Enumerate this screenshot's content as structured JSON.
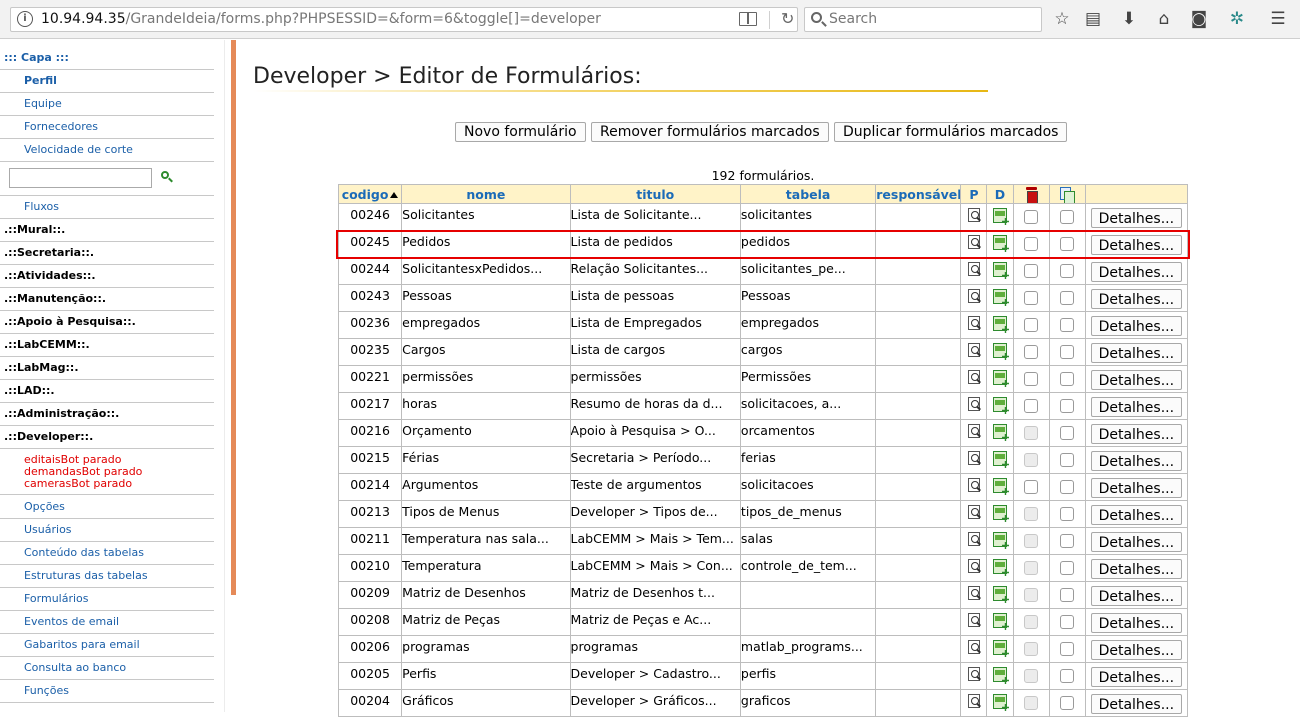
{
  "browser": {
    "url_host": "10.94.94.35",
    "url_path": "/GrandeIdeia/forms.php?PHPSESSID=&form=6&toggle[]=developer",
    "search_placeholder": "Search"
  },
  "sidebar": {
    "capa": "::: Capa :::",
    "capa_items": [
      "Perfil",
      "Equipe",
      "Fornecedores",
      "Velocidade de corte"
    ],
    "search_value": "",
    "fluxos": "Fluxos",
    "sections": [
      ".::Mural::.",
      ".::Secretaria::.",
      ".::Atividades::.",
      ".::Manutenção::.",
      ".::Apoio à Pesquisa::.",
      ".::LabCEMM::.",
      ".::LabMag::.",
      ".::LAD::.",
      ".::Administração::.",
      ".::Developer::."
    ],
    "bot_status": [
      "editaisBot parado",
      "demandasBot parado",
      "camerasBot parado"
    ],
    "developer_items": [
      "Opções",
      "Usuários",
      "Conteúdo das tabelas",
      "Estruturas das tabelas",
      "Formulários",
      "Eventos de email",
      "Gabaritos para email",
      "Consulta ao banco",
      "Funções"
    ]
  },
  "main": {
    "title": "Developer > Editor de Formulários:",
    "buttons": {
      "new": "Novo formulário",
      "remove": "Remover formulários marcados",
      "duplicate": "Duplicar formulários marcados"
    },
    "count": "192 formulários.",
    "columns": {
      "codigo": "codigo",
      "nome": "nome",
      "titulo": "titulo",
      "tabela": "tabela",
      "responsavel": "responsável",
      "p": "P",
      "d": "D"
    },
    "details_label": "Detalhes...",
    "rows": [
      {
        "codigo": "00246",
        "nome": "Solicitantes",
        "titulo": "Lista de Solicitante...",
        "tabela": "solicitantes",
        "responsavel": "",
        "del_enabled": true
      },
      {
        "codigo": "00245",
        "nome": "Pedidos",
        "titulo": "Lista de pedidos",
        "tabela": "pedidos",
        "responsavel": "",
        "del_enabled": true
      },
      {
        "codigo": "00244",
        "nome": "SolicitantesxPedidos...",
        "titulo": "Relação Solicitantes...",
        "tabela": "solicitantes_pe...",
        "responsavel": "",
        "del_enabled": true
      },
      {
        "codigo": "00243",
        "nome": "Pessoas",
        "titulo": "Lista de pessoas",
        "tabela": "Pessoas",
        "responsavel": "",
        "del_enabled": true
      },
      {
        "codigo": "00236",
        "nome": "empregados",
        "titulo": "Lista de Empregados",
        "tabela": "empregados",
        "responsavel": "",
        "del_enabled": true
      },
      {
        "codigo": "00235",
        "nome": "Cargos",
        "titulo": "Lista de cargos",
        "tabela": "cargos",
        "responsavel": "",
        "del_enabled": true
      },
      {
        "codigo": "00221",
        "nome": "permissões",
        "titulo": "permissões",
        "tabela": "Permissões",
        "responsavel": "",
        "del_enabled": true
      },
      {
        "codigo": "00217",
        "nome": "horas",
        "titulo": "Resumo de horas da d...",
        "tabela": "solicitacoes, a...",
        "responsavel": "",
        "del_enabled": true
      },
      {
        "codigo": "00216",
        "nome": "Orçamento",
        "titulo": "Apoio à Pesquisa > O...",
        "tabela": "orcamentos",
        "responsavel": "",
        "del_enabled": false
      },
      {
        "codigo": "00215",
        "nome": "Férias",
        "titulo": "Secretaria > Período...",
        "tabela": "ferias",
        "responsavel": "",
        "del_enabled": false
      },
      {
        "codigo": "00214",
        "nome": "Argumentos",
        "titulo": "Teste de argumentos",
        "tabela": "solicitacoes",
        "responsavel": "",
        "del_enabled": true
      },
      {
        "codigo": "00213",
        "nome": "Tipos de Menus",
        "titulo": "Developer > Tipos de...",
        "tabela": "tipos_de_menus",
        "responsavel": "",
        "del_enabled": false
      },
      {
        "codigo": "00211",
        "nome": "Temperatura nas sala...",
        "titulo": "LabCEMM > Mais > Tem...",
        "tabela": "salas",
        "responsavel": "",
        "del_enabled": false
      },
      {
        "codigo": "00210",
        "nome": "Temperatura",
        "titulo": "LabCEMM > Mais > Con...",
        "tabela": "controle_de_tem...",
        "responsavel": "",
        "del_enabled": false
      },
      {
        "codigo": "00209",
        "nome": "Matriz de Desenhos",
        "titulo": "Matriz de Desenhos t...",
        "tabela": "",
        "responsavel": "",
        "del_enabled": false
      },
      {
        "codigo": "00208",
        "nome": "Matriz de Peças",
        "titulo": "Matriz de Peças e Ac...",
        "tabela": "",
        "responsavel": "",
        "del_enabled": false
      },
      {
        "codigo": "00206",
        "nome": "programas",
        "titulo": "programas",
        "tabela": "matlab_programs...",
        "responsavel": "",
        "del_enabled": false
      },
      {
        "codigo": "00205",
        "nome": "Perfis",
        "titulo": "Developer > Cadastro...",
        "tabela": "perfis",
        "responsavel": "",
        "del_enabled": false
      },
      {
        "codigo": "00204",
        "nome": "Gráficos",
        "titulo": "Developer > Gráficos...",
        "tabela": "graficos",
        "responsavel": "",
        "del_enabled": false
      }
    ]
  },
  "colors": {
    "link": "#1b5fa8",
    "header_bg": "#fff3c8",
    "highlight": "#e60000",
    "bot_status": "#e00000",
    "scroll_accent": "#e58a58"
  }
}
